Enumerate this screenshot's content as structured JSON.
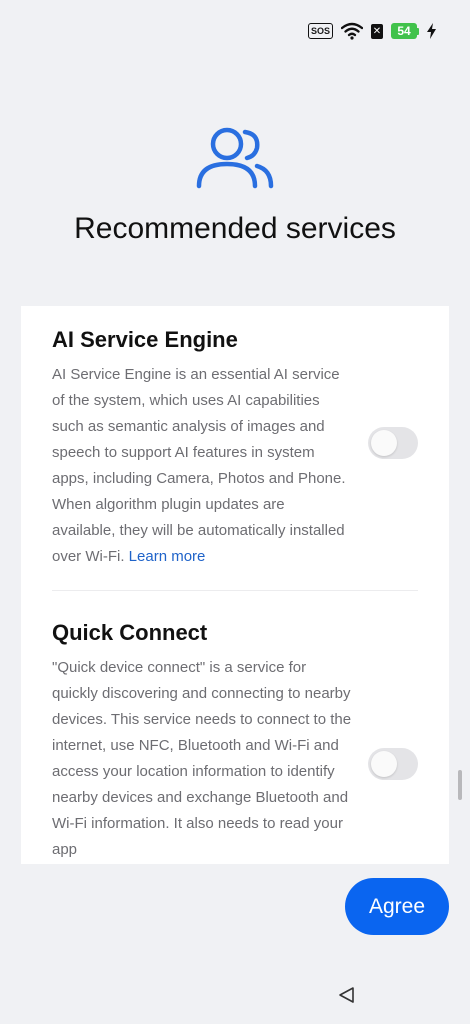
{
  "status_bar": {
    "sos_label": "SOS",
    "no_sim_label": "✕",
    "battery_level": "54",
    "icons": [
      "wifi-icon",
      "no-sim-icon",
      "battery-icon",
      "charging-icon"
    ]
  },
  "header": {
    "icon": "users-icon",
    "title": "Recommended services"
  },
  "services": [
    {
      "title": "AI Service Engine",
      "description": "AI Service Engine is an essential AI service of the system, which uses AI capabilities such as semantic analysis of images and speech to support AI features in system apps, including Camera, Photos and Phone. When algorithm plugin updates are available, they will be automatically installed over Wi-Fi.",
      "link_label": "Learn more",
      "enabled": false
    },
    {
      "title": "Quick Connect",
      "description": "\"Quick device connect\" is a service for quickly discovering and connecting to nearby devices. This service needs to connect to the internet, use NFC, Bluetooth and Wi-Fi and access your location information to identify nearby devices and exchange Bluetooth and Wi-Fi information. It also needs to read your app",
      "enabled": false
    }
  ],
  "actions": {
    "agree_label": "Agree"
  },
  "colors": {
    "accent": "#0a65f0",
    "link": "#1f63c9",
    "icon_blue": "#2a6fe0",
    "background": "#f0f1f4",
    "battery": "#41c24b"
  }
}
